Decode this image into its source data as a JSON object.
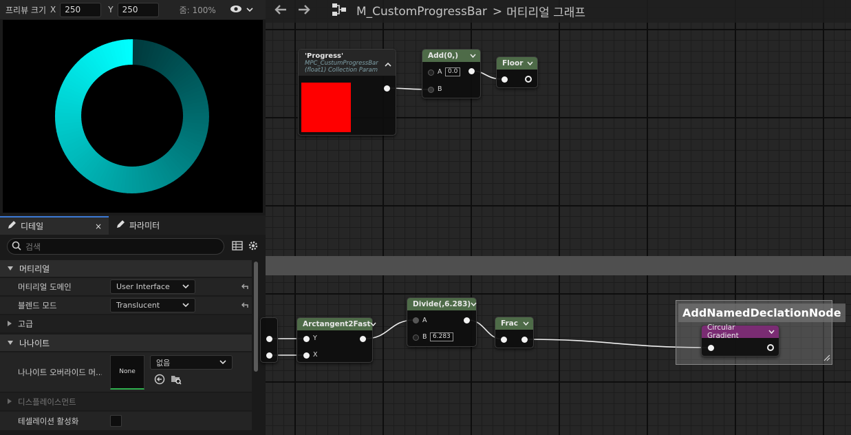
{
  "preview": {
    "title": "프리뷰 크기",
    "x_label": "X",
    "x_value": "250",
    "y_label": "Y",
    "y_value": "250",
    "zoom": "줌: 100%"
  },
  "tabs": [
    {
      "label": "디테일",
      "close": "×"
    },
    {
      "label": "파라미터"
    }
  ],
  "details": {
    "search_placeholder": "검색",
    "section_material": "머티리얼",
    "material_domain_label": "머티리얼 도메인",
    "material_domain_value": "User Interface",
    "blend_mode_label": "블렌드 모드",
    "blend_mode_value": "Translucent",
    "advanced_label": "고급",
    "section_nanite": "나나이트",
    "nanite_override_label": "나나이트 오버라이드 머...",
    "nanite_thumb_label": "None",
    "nanite_override_value": "없음",
    "displacement_label": "디스플레이스먼트",
    "tessellation_label": "테셀레이션 활성화"
  },
  "breadcrumb": {
    "asset": "M_CustomProgressBar",
    "separator": ">",
    "graph": "머티리얼 그래프"
  },
  "nodes": {
    "progress": {
      "title": "'Progress'",
      "subtitle1": "MPC_CustumProgressBar",
      "subtitle2": "(float1) Collection Param",
      "color": "#ff0000"
    },
    "add": {
      "title": "Add(0,)",
      "pin_a": "A",
      "pin_a_value": "0.0",
      "pin_b": "B"
    },
    "floor": {
      "title": "Floor"
    },
    "arctan": {
      "title": "Arctangent2Fast",
      "pin_y": "Y",
      "pin_x": "X"
    },
    "divide": {
      "title": "Divide(,6.283)",
      "pin_a": "A",
      "pin_b": "B",
      "pin_b_value": "6.283"
    },
    "frac": {
      "title": "Frac"
    },
    "circular": {
      "title": "Circular Gradient"
    }
  },
  "comment": {
    "title": "AddNamedDeclationNode"
  },
  "colors": {
    "accent_blue": "#3c7ad6",
    "node_header_green": "#4e6b48",
    "node_header_purple": "#7a2c73",
    "ring_light": "#00ffff",
    "ring_dark": "#00393c"
  }
}
